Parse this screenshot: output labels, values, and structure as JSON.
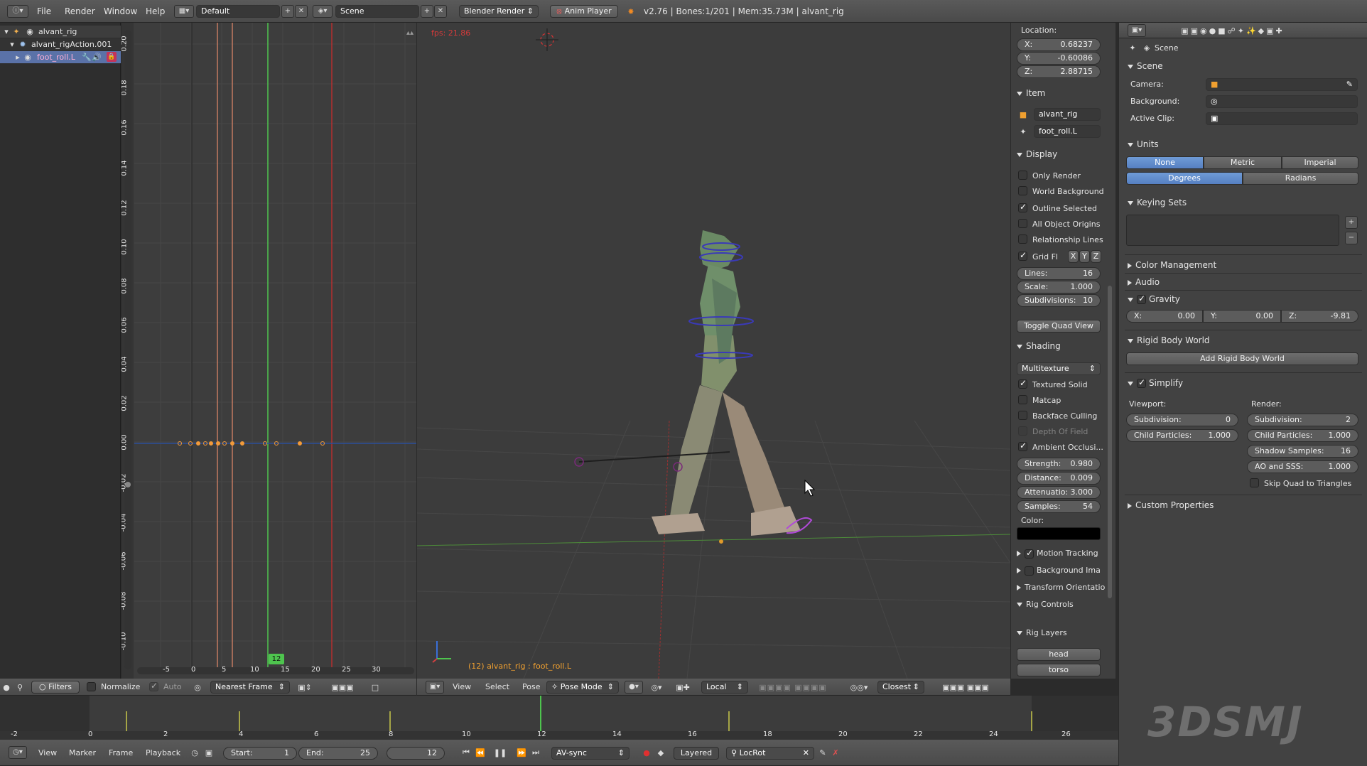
{
  "topbar": {
    "menus": [
      "File",
      "Render",
      "Window",
      "Help"
    ],
    "layout": "Default",
    "scene": "Scene",
    "engine": "Blender Render",
    "anim_player": "Anim Player",
    "stats": "v2.76 | Bones:1/201 | Mem:35.73M | alvant_rig"
  },
  "outliner": {
    "items": [
      {
        "label": "alvant_rig"
      },
      {
        "label": "alvant_rigAction.001"
      },
      {
        "label": "foot_roll.L"
      }
    ]
  },
  "graph": {
    "y_ticks": [
      "0.20",
      "0.18",
      "0.16",
      "0.14",
      "0.12",
      "0.10",
      "0.08",
      "0.06",
      "0.04",
      "0.02",
      "0.00",
      "-0.02",
      "-0.04",
      "-0.06",
      "-0.08",
      "-0.10"
    ],
    "x_ticks": [
      "-5",
      "0",
      "5",
      "10",
      "15",
      "20",
      "25",
      "30"
    ],
    "current_frame": "12",
    "footer": {
      "filters": "Filters",
      "normalize": "Normalize",
      "auto": "Auto",
      "snap": "Nearest Frame"
    }
  },
  "viewport": {
    "fps": "fps: 21.86",
    "object_info": "(12) alvant_rig : foot_roll.L",
    "header": {
      "menus": [
        "View",
        "Select",
        "Pose"
      ],
      "mode": "Pose Mode",
      "orientation": "Local",
      "snap": "Closest"
    }
  },
  "n_panel": {
    "location_label": "Location:",
    "location": [
      {
        "axis": "X:",
        "value": "0.68237"
      },
      {
        "axis": "Y:",
        "value": "-0.60086"
      },
      {
        "axis": "Z:",
        "value": "2.88715"
      }
    ],
    "item_header": "Item",
    "item_object": "alvant_rig",
    "item_bone": "foot_roll.L",
    "display_header": "Display",
    "display_checks": [
      {
        "label": "Only Render",
        "on": false
      },
      {
        "label": "World Background",
        "on": false
      },
      {
        "label": "Outline Selected",
        "on": true
      },
      {
        "label": "All Object Origins",
        "on": false
      },
      {
        "label": "Relationship Lines",
        "on": false
      }
    ],
    "grid_label": "Grid Fl",
    "grid_axes": [
      "X",
      "Y",
      "Z"
    ],
    "grid_fields": [
      {
        "label": "Lines:",
        "value": "16"
      },
      {
        "label": "Scale:",
        "value": "1.000"
      },
      {
        "label": "Subdivisions:",
        "value": "10"
      }
    ],
    "toggle_quad": "Toggle Quad View",
    "shading_header": "Shading",
    "shading_mode": "Multitexture",
    "shading_checks": [
      {
        "label": "Textured Solid",
        "on": true
      },
      {
        "label": "Matcap",
        "on": false
      },
      {
        "label": "Backface Culling",
        "on": false
      },
      {
        "label": "Depth Of Field",
        "on": false
      },
      {
        "label": "Ambient Occlusi...",
        "on": true
      }
    ],
    "ao_fields": [
      {
        "label": "Strength:",
        "value": "0.980"
      },
      {
        "label": "Distance:",
        "value": "0.009"
      },
      {
        "label": "Attenuatio:",
        "value": "3.000"
      },
      {
        "label": "Samples:",
        "value": "54"
      }
    ],
    "color_label": "Color:",
    "collapsed": [
      "Motion Tracking",
      "Background Ima",
      "Transform Orientatio"
    ],
    "rig_controls": "Rig Controls",
    "rig_layers": "Rig Layers",
    "rig_buttons": [
      "head",
      "torso"
    ]
  },
  "properties": {
    "context": "Scene",
    "scene_header": "Scene",
    "camera_label": "Camera:",
    "background_label": "Background:",
    "clip_label": "Active Clip:",
    "units_header": "Units",
    "units_system": [
      "None",
      "Metric",
      "Imperial"
    ],
    "units_rotation": [
      "Degrees",
      "Radians"
    ],
    "keying_header": "Keying Sets",
    "color_mgmt": "Color Management",
    "audio": "Audio",
    "gravity": "Gravity",
    "gravity_vals": [
      {
        "axis": "X:",
        "value": "0.00"
      },
      {
        "axis": "Y:",
        "value": "0.00"
      },
      {
        "axis": "Z:",
        "value": "-9.81"
      }
    ],
    "rigid_header": "Rigid Body World",
    "add_rigid": "Add Rigid Body World",
    "simplify": "Simplify",
    "viewport_label": "Viewport:",
    "render_label": "Render:",
    "simplify_viewport": [
      {
        "label": "Subdivision:",
        "value": "0"
      },
      {
        "label": "Child Particles:",
        "value": "1.000"
      }
    ],
    "simplify_render": [
      {
        "label": "Subdivision:",
        "value": "2"
      },
      {
        "label": "Child Particles:",
        "value": "1.000"
      },
      {
        "label": "Shadow Samples:",
        "value": "16"
      },
      {
        "label": "AO and SSS:",
        "value": "1.000"
      }
    ],
    "skip_quad": "Skip Quad to Triangles",
    "custom_props": "Custom Properties"
  },
  "timeline": {
    "ruler": [
      "-2",
      "0",
      "2",
      "4",
      "6",
      "8",
      "10",
      "12",
      "14",
      "16",
      "18",
      "20",
      "22",
      "24",
      "26"
    ],
    "menus": [
      "View",
      "Marker",
      "Frame",
      "Playback"
    ],
    "start_label": "Start:",
    "start": "1",
    "end_label": "End:",
    "end": "25",
    "current": "12",
    "sync": "AV-sync",
    "layered": "Layered",
    "keying": "LocRot"
  },
  "watermark": "3DSMJ"
}
